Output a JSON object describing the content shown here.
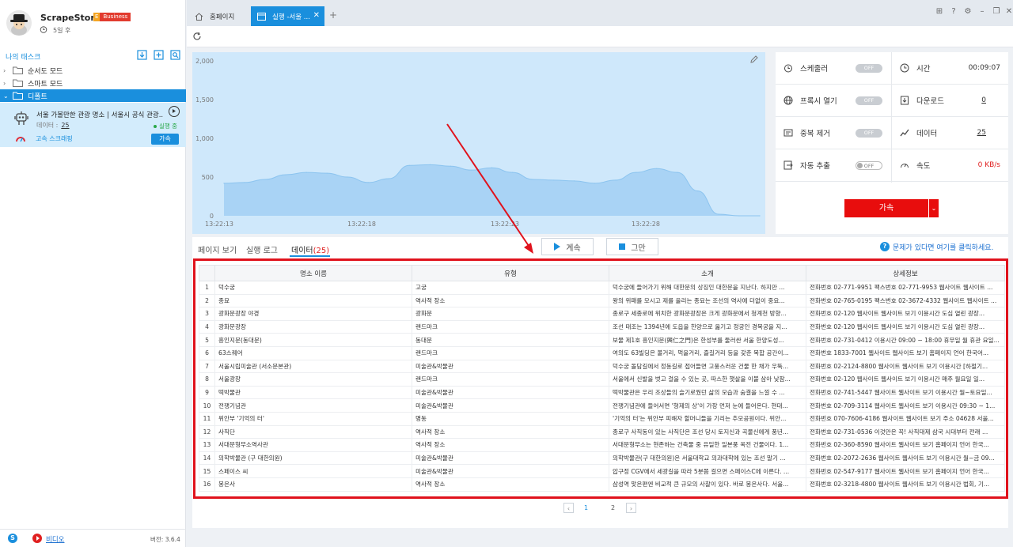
{
  "app": {
    "name": "ScrapeStorm",
    "edition_e": "E",
    "edition": "Business",
    "expiry": "5일 후"
  },
  "sidebar": {
    "tasks_title": "나의 태스크",
    "folders": [
      {
        "label": "순서도 모드"
      },
      {
        "label": "스마트 모드"
      },
      {
        "label": "디폴트"
      }
    ],
    "task": {
      "name": "서울 가볼만한 관광 명소 | 서울시 공식 관광...",
      "data_label": "데이터 :",
      "data_value": "25",
      "status": "실행 중",
      "speed_label": "고속 스크래핑",
      "accel_button": "가속"
    },
    "footer": {
      "video_link": "비디오",
      "version": "버전: 3.6.4"
    }
  },
  "tabs": [
    {
      "label": "홈페이지"
    },
    {
      "label": "실행 -서울 ..."
    }
  ],
  "chart_data": {
    "type": "area",
    "x": [
      "13:22:13",
      "13:22:18",
      "13:22:23",
      "13:22:28"
    ],
    "ylim": [
      0,
      2000
    ],
    "yticks": [
      "2,000",
      "1,500",
      "1,000",
      "500",
      "0"
    ],
    "series": [
      {
        "values": [
          420,
          430,
          470,
          530,
          560,
          550,
          500,
          430,
          480,
          650,
          660,
          640,
          590,
          620,
          560,
          470,
          460,
          450,
          420,
          460,
          560,
          610,
          560,
          320,
          20,
          0,
          0
        ]
      }
    ],
    "fill_color": "#a9d3f5",
    "line_color": "#8cc4ef",
    "grid": false
  },
  "stats": {
    "scheduler": {
      "label": "스케줄러",
      "value": "OFF"
    },
    "time": {
      "label": "시간",
      "value": "00:09:07"
    },
    "browser": {
      "label": "프록시 열기",
      "value": "OFF"
    },
    "download": {
      "label": "다운로드",
      "value": "0"
    },
    "dedupe": {
      "label": "중복 제거",
      "value": "OFF"
    },
    "data": {
      "label": "데이터",
      "value": "25"
    },
    "auto_export": {
      "label": "자동 추출",
      "value": "OFF"
    },
    "speed": {
      "label": "속도",
      "value": "0 KB/s"
    },
    "accel_button": "가속"
  },
  "subtabs": {
    "page_view": "페이지 보기",
    "run_log": "실행 로그",
    "data": "데이터",
    "data_count": "(25)"
  },
  "buttons": {
    "continue": "계속",
    "stop": "그만"
  },
  "help_text": "문제가 있다면 여기를 클릭하세요.",
  "table": {
    "columns": [
      "",
      "명소 이름",
      "유형",
      "소개",
      "상세정보"
    ],
    "rows": [
      [
        "1",
        "덕수궁",
        "고궁",
        "덕수궁에 들어가기 위해 대한문의 상징인 대한문을 지난다. 하지만 ...",
        "전화번호 02-771-9951 팩스번호 02-771-9953 웹사이트 웹사이트 ..."
      ],
      [
        "2",
        "종묘",
        "역사적 장소",
        "왕의 위패를 모시고 제를 올리는 종묘는 조선의 역사에 더없이 중요...",
        "전화번호 02-765-0195 팩스번호 02-3672-4332 웹사이트 웹사이트 ..."
      ],
      [
        "3",
        "광화문광장 야경",
        "광화문",
        "종로구 세종로에 위치한 광화문광장은 크게 광화문에서 청계천 방향...",
        "전화번호 02-120 웹사이트 웹사이트 보기 이용시간 도심 열린 광장..."
      ],
      [
        "4",
        "광화문광장",
        "랜드마크",
        "조선 태조는 1394년에 도읍을 한양으로 옮기고 정궁인 경복궁을 지...",
        "전화번호 02-120 웹사이트 웹사이트 보기 이용시간 도심 열린 광장..."
      ],
      [
        "5",
        "흥인지문(동대문)",
        "동대문",
        "보물 제1호 흥인지문(興仁之門)은 한성부를 둘러싼 서울 한양도성...",
        "전화번호 02-731-0412 이용시간 09:00 ~ 18:00 휴무일 월 휴관 요일..."
      ],
      [
        "6",
        "63스퀘어",
        "랜드마크",
        "여의도 63빌딩은 볼거리, 먹을거리, 즐길거리 등을 갖춘 복합 공간이...",
        "전화번호 1833-7001 웹사이트 웹사이트 보기 홈페이지 언어 한국어..."
      ],
      [
        "7",
        "서울시립미술관 (서소문본관)",
        "미술관&박물관",
        "덕수궁 돌담길에서 정동길로 접어들면 고풍스러운 건물 한 채가 우뚝...",
        "전화번호 02-2124-8800 웹사이트 웹사이트 보기 이용시간 [하절기..."
      ],
      [
        "8",
        "서울광장",
        "랜드마크",
        "서울에서 신발을 벗고 걸을 수 있는 곳, 따스한 햇살을 이불 삼아 낮잠...",
        "전화번호 02-120 웹사이트 웹사이트 보기 이용시간 매주 월요일 일..."
      ],
      [
        "9",
        "떡박물관",
        "미술관&박물관",
        "떡박물관은 우리 조상들의 슬기로웠던 삶의 모습과 숨결을 느낄 수 ...",
        "전화번호 02-741-5447 웹사이트 웹사이트 보기 이용시간 월~토요일..."
      ],
      [
        "10",
        "전쟁기념관",
        "미술관&박물관",
        "전쟁기념관에 들어서면 '형제의 상'이 가장 먼저 눈에 들어온다. 현대...",
        "전화번호 02-709-3114 웹사이트 웹사이트 보기 이용시간 09:30 ~ 1..."
      ],
      [
        "11",
        "위안부 '기억의 터'",
        "명동",
        "'기억의 터'는 위안부 피해자 할머니들을 기리는 추모공원이다. 위안...",
        "전화번호 070-7606-4186 웹사이트 웹사이트 보기 주소 04628 서울..."
      ],
      [
        "12",
        "사직단",
        "역사적 장소",
        "종로구 사직동이 있는 사직단은 조선 당시 토지신과 곡물신에게 풍년...",
        "전화번호 02-731-0536 이것만은 꼭! 사직대제 삼국 시대부터 전래 ..."
      ],
      [
        "13",
        "서대문형무소역사관",
        "역사적 장소",
        "서대문형무소는 현존하는 건축물 중 유일한 일본풍 옥전 건물이다. 1...",
        "전화번호 02-360-8590 웹사이트 웹사이트 보기 홈페이지 언어 한국..."
      ],
      [
        "14",
        "의학박물관 (구 대한의원)",
        "미술관&박물관",
        "의학박물관(구 대한의원)은 서울대학교 의과대학에 있는 조선 말기 ...",
        "전화번호 02-2072-2636 웹사이트 웹사이트 보기 이용시간 월~금 09..."
      ],
      [
        "15",
        "스페이스 씨",
        "미술관&박물관",
        "압구정 CGV에서 세광길을 따라 5분쯤 걸으면 스페이스C에 이른다. ...",
        "전화번호 02-547-9177 웹사이트 웹사이트 보기 홈페이지 언어 한국..."
      ],
      [
        "16",
        "봉은사",
        "역사적 장소",
        "삼성역 맞은편엔 비교적 큰 규모의 사찰이 있다. 바로 봉은사다. 서울...",
        "전화번호 02-3218-4800 웹사이트 웹사이트 보기 이용시간 법회, 기..."
      ]
    ]
  },
  "pager": {
    "pages": [
      "1",
      "2"
    ],
    "current": "1"
  },
  "colors": {
    "accent": "#1a8fdd",
    "danger": "#e80d0d",
    "annotation": "#e0121c"
  }
}
